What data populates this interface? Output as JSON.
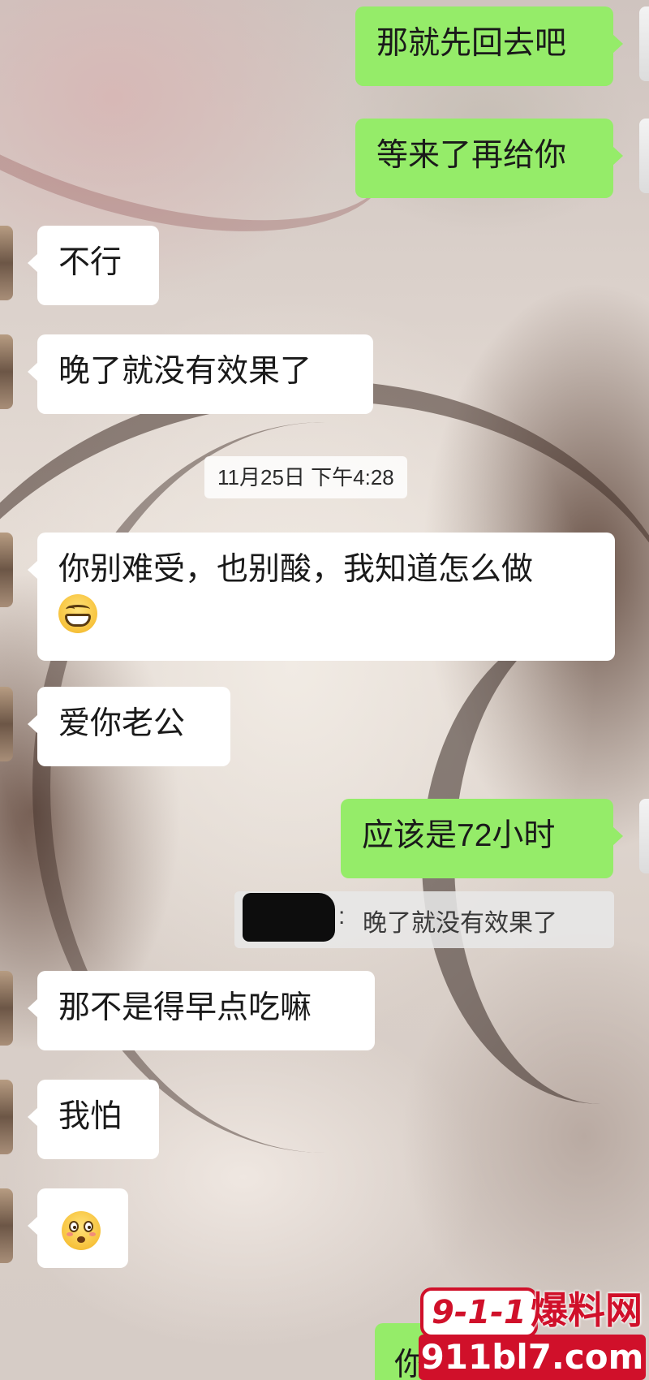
{
  "messages": [
    {
      "side": "out",
      "text": "那就先回去吧"
    },
    {
      "side": "out",
      "text": "等来了再给你"
    },
    {
      "side": "in",
      "text": "不行"
    },
    {
      "side": "in",
      "text": "晚了就没有效果了"
    },
    {
      "side": "in",
      "text": "你别难受，也别酸，我知道怎么做",
      "emoji": "grinning-face-emoji"
    },
    {
      "side": "in",
      "text": "爱你老公"
    },
    {
      "side": "out",
      "text": "应该是72小时"
    },
    {
      "side": "in",
      "text": "那不是得早点吃嘛"
    },
    {
      "side": "in",
      "text": "我怕"
    },
    {
      "side": "in",
      "text": "",
      "emoji": "flushed-face-emoji"
    }
  ],
  "timestamp": "11月25日 下午4:28",
  "quote": {
    "separator": ":",
    "text": "晚了就没有效果了"
  },
  "partial_message": "你",
  "watermark": {
    "badge": "9-1-1",
    "site_name": "爆料网",
    "url": "911bl7.com"
  },
  "colors": {
    "outgoing_bubble": "#95ec69",
    "incoming_bubble": "#ffffff",
    "watermark_red": "#d0102a"
  }
}
